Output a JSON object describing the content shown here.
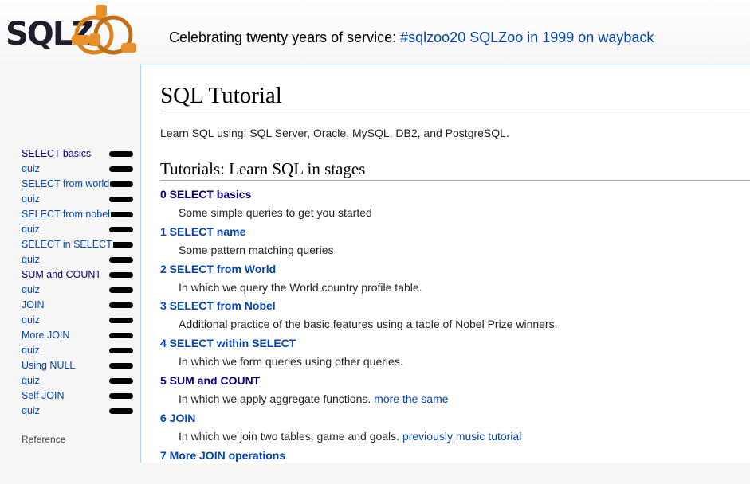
{
  "header": {
    "logo_text": "SQLZOO",
    "banner_text": "Celebrating twenty years of service: ",
    "banner_link": "#sqlzoo20 SQLZoo in 1999 on wayback",
    "colors": {
      "link": "#0645ad",
      "visited": "#0b0080",
      "border": "#a7d7f9"
    }
  },
  "sidebar": {
    "items": [
      {
        "label": "SELECT basics",
        "visited": true
      },
      {
        "label": "quiz",
        "visited": false
      },
      {
        "label": "SELECT from world",
        "visited": false
      },
      {
        "label": "quiz",
        "visited": false
      },
      {
        "label": "SELECT from nobel",
        "visited": false
      },
      {
        "label": "quiz",
        "visited": false
      },
      {
        "label": "SELECT in SELECT",
        "visited": false
      },
      {
        "label": "quiz",
        "visited": false
      },
      {
        "label": "SUM and COUNT",
        "visited": true
      },
      {
        "label": "quiz",
        "visited": false
      },
      {
        "label": "JOIN",
        "visited": false
      },
      {
        "label": "quiz",
        "visited": false
      },
      {
        "label": "More JOIN",
        "visited": false
      },
      {
        "label": "quiz",
        "visited": false
      },
      {
        "label": "Using NULL",
        "visited": false
      },
      {
        "label": "quiz",
        "visited": false
      },
      {
        "label": "Self JOIN",
        "visited": false
      },
      {
        "label": "quiz",
        "visited": false
      }
    ],
    "reference_label": "Reference"
  },
  "main": {
    "title": "SQL Tutorial",
    "intro": "Learn SQL using: SQL Server, Oracle, MySQL, DB2, and PostgreSQL.",
    "subtitle": "Tutorials: Learn SQL in stages",
    "tutorials": [
      {
        "title": "0 SELECT basics",
        "desc": "Some simple queries to get you started",
        "extra_link": "",
        "visited": true
      },
      {
        "title": "1 SELECT name",
        "desc": "Some pattern matching queries",
        "extra_link": "",
        "visited": false
      },
      {
        "title": "2 SELECT from World",
        "desc": "In which we query the World country profile table.",
        "extra_link": "",
        "visited": false
      },
      {
        "title": "3 SELECT from Nobel",
        "desc": "Additional practice of the basic features using a table of Nobel Prize winners.",
        "extra_link": "",
        "visited": false
      },
      {
        "title": "4 SELECT within SELECT",
        "desc": "In which we form queries using other queries.",
        "extra_link": "",
        "visited": false
      },
      {
        "title": "5 SUM and COUNT",
        "desc": "In which we apply aggregate functions.",
        "extra_link": "more the same",
        "visited": true
      },
      {
        "title": "6 JOIN",
        "desc": "In which we join two tables; game and goals.",
        "extra_link": "previously music tutorial",
        "visited": false
      },
      {
        "title": "7 More JOIN operations",
        "desc": "",
        "extra_link": "",
        "visited": false
      }
    ]
  }
}
